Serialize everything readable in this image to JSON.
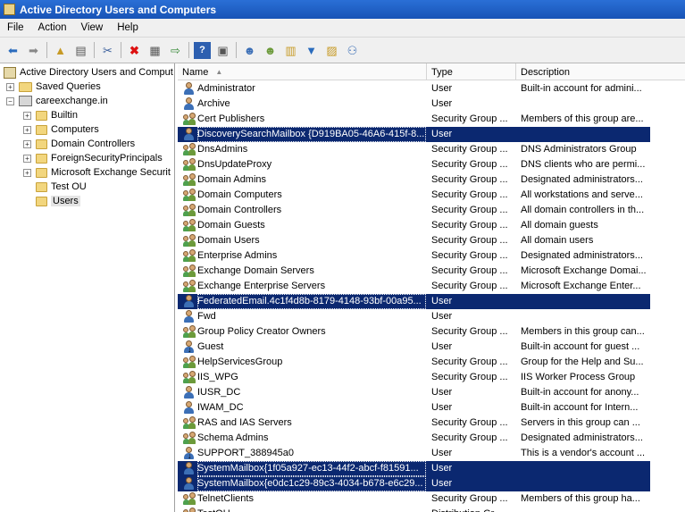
{
  "window": {
    "title": "Active Directory Users and Computers"
  },
  "menu": [
    "File",
    "Action",
    "View",
    "Help"
  ],
  "toolbar": [
    "back-icon",
    "forward-icon",
    "up-folder-icon",
    "show-tree-icon",
    "cut-icon",
    "delete-icon",
    "properties-icon",
    "export-icon",
    "help-icon",
    "console-icon",
    "new-user-icon",
    "new-group-icon",
    "new-ou-icon",
    "filter-icon",
    "find-icon",
    "move-icon"
  ],
  "tree": {
    "root": "Active Directory Users and Comput",
    "saved_queries": "Saved Queries",
    "domain": "careexchange.in",
    "children": [
      "Builtin",
      "Computers",
      "Domain Controllers",
      "ForeignSecurityPrincipals",
      "Microsoft Exchange Securit",
      "Test OU",
      "Users"
    ]
  },
  "columns": {
    "name": "Name",
    "type": "Type",
    "description": "Description"
  },
  "rows": [
    {
      "name": "Administrator",
      "type": "User",
      "desc": "Built-in account for admini...",
      "icon": "user",
      "sel": false
    },
    {
      "name": "Archive",
      "type": "User",
      "desc": "",
      "icon": "user",
      "sel": false
    },
    {
      "name": "Cert Publishers",
      "type": "Security Group ...",
      "desc": "Members of this group are...",
      "icon": "group",
      "sel": false
    },
    {
      "name": "DiscoverySearchMailbox {D919BA05-46A6-415f-8...",
      "type": "User",
      "desc": "",
      "icon": "user",
      "sel": true
    },
    {
      "name": "DnsAdmins",
      "type": "Security Group ...",
      "desc": "DNS Administrators Group",
      "icon": "group",
      "sel": false
    },
    {
      "name": "DnsUpdateProxy",
      "type": "Security Group ...",
      "desc": "DNS clients who are permi...",
      "icon": "group",
      "sel": false
    },
    {
      "name": "Domain Admins",
      "type": "Security Group ...",
      "desc": "Designated administrators...",
      "icon": "group",
      "sel": false
    },
    {
      "name": "Domain Computers",
      "type": "Security Group ...",
      "desc": "All workstations and serve...",
      "icon": "group",
      "sel": false
    },
    {
      "name": "Domain Controllers",
      "type": "Security Group ...",
      "desc": "All domain controllers in th...",
      "icon": "group",
      "sel": false
    },
    {
      "name": "Domain Guests",
      "type": "Security Group ...",
      "desc": "All domain guests",
      "icon": "group",
      "sel": false
    },
    {
      "name": "Domain Users",
      "type": "Security Group ...",
      "desc": "All domain users",
      "icon": "group",
      "sel": false
    },
    {
      "name": "Enterprise Admins",
      "type": "Security Group ...",
      "desc": "Designated administrators...",
      "icon": "group",
      "sel": false
    },
    {
      "name": "Exchange Domain Servers",
      "type": "Security Group ...",
      "desc": "Microsoft Exchange Domai...",
      "icon": "group",
      "sel": false
    },
    {
      "name": "Exchange Enterprise Servers",
      "type": "Security Group ...",
      "desc": "Microsoft Exchange Enter...",
      "icon": "group",
      "sel": false
    },
    {
      "name": "FederatedEmail.4c1f4d8b-8179-4148-93bf-00a95...",
      "type": "User",
      "desc": "",
      "icon": "user",
      "sel": true
    },
    {
      "name": "Fwd",
      "type": "User",
      "desc": "",
      "icon": "user",
      "sel": false
    },
    {
      "name": "Group Policy Creator Owners",
      "type": "Security Group ...",
      "desc": "Members in this group can...",
      "icon": "group",
      "sel": false
    },
    {
      "name": "Guest",
      "type": "User",
      "desc": "Built-in account for guest ...",
      "icon": "user-disabled",
      "sel": false
    },
    {
      "name": "HelpServicesGroup",
      "type": "Security Group ...",
      "desc": "Group for the Help and Su...",
      "icon": "group",
      "sel": false
    },
    {
      "name": "IIS_WPG",
      "type": "Security Group ...",
      "desc": "IIS Worker Process Group",
      "icon": "group",
      "sel": false
    },
    {
      "name": "IUSR_DC",
      "type": "User",
      "desc": "Built-in account for anony...",
      "icon": "user",
      "sel": false
    },
    {
      "name": "IWAM_DC",
      "type": "User",
      "desc": "Built-in account for Intern...",
      "icon": "user",
      "sel": false
    },
    {
      "name": "RAS and IAS Servers",
      "type": "Security Group ...",
      "desc": "Servers in this group can ...",
      "icon": "group",
      "sel": false
    },
    {
      "name": "Schema Admins",
      "type": "Security Group ...",
      "desc": "Designated administrators...",
      "icon": "group",
      "sel": false
    },
    {
      "name": "SUPPORT_388945a0",
      "type": "User",
      "desc": "This is a vendor's account ...",
      "icon": "user-disabled",
      "sel": false
    },
    {
      "name": "SystemMailbox{1f05a927-ec13-44f2-abcf-f81591...",
      "type": "User",
      "desc": "",
      "icon": "user",
      "sel": true
    },
    {
      "name": "SystemMailbox{e0dc1c29-89c3-4034-b678-e6c29...",
      "type": "User",
      "desc": "",
      "icon": "user",
      "sel": true
    },
    {
      "name": "TelnetClients",
      "type": "Security Group ...",
      "desc": "Members of this group ha...",
      "icon": "group",
      "sel": false
    },
    {
      "name": "TestOU",
      "type": "Distribution Gr...",
      "desc": "",
      "icon": "group",
      "sel": false
    }
  ]
}
